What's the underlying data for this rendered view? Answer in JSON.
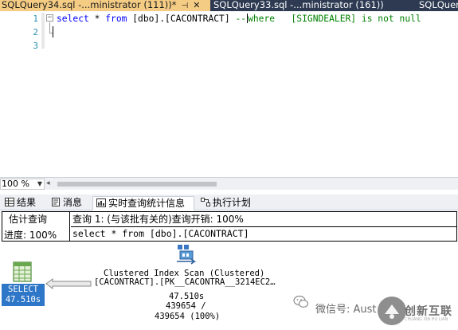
{
  "tabs": [
    {
      "label": "SQLQuery34.sql -...ministrator (111))*",
      "pin_glyph": "⊣",
      "close_glyph": "✕"
    },
    {
      "label": "SQLQuery33.sql -...ministrator (161))"
    },
    {
      "label": "SQLQuer"
    }
  ],
  "editor": {
    "line_numbers": [
      "1",
      "2",
      "3"
    ],
    "code": {
      "kw_select": "select",
      "star": " * ",
      "kw_from": "from",
      "object": " [dbo].[CACONTRACT] ",
      "comment_a": "--",
      "comment_b": "where   [SIGNDEALER] is not null"
    },
    "fold_glyph": "−"
  },
  "zoom": {
    "value": "100 %",
    "arrow": "▼",
    "scroll_left": "◂"
  },
  "result_tabs": [
    {
      "label": "结果",
      "icon": "grid-icon"
    },
    {
      "label": "消息",
      "icon": "message-icon"
    },
    {
      "label": "实时查询统计信息",
      "icon": "live-stats-icon"
    },
    {
      "label": "执行计划",
      "icon": "execution-plan-icon"
    }
  ],
  "stats": {
    "estimate_label": "估计查询",
    "progress_label": "进度: 100%",
    "query_header": "查询 1: (与该批有关的)查询开销: 100%",
    "query_text": "select * from [dbo].[CACONTRACT]"
  },
  "plan": {
    "select_node": {
      "label": "SELECT",
      "time": "47.510s"
    },
    "scan_node": {
      "title": "Clustered Index Scan (Clustered)",
      "object": "[CACONTRACT].[PK__CACONTRA__3214EC2…",
      "time": "47.510s",
      "rows": "439654 /",
      "total": "439654 (100%)"
    }
  },
  "watermark": {
    "wechat": "微信号: Aust",
    "brand": "创新互联",
    "sub": "CHUANG XIN HU LIAN"
  },
  "colors": {
    "tab_active": "#f5cc84",
    "tab_bar": "#2d3a52",
    "select_node": "#2e76c7",
    "keyword": "#0000ff",
    "comment": "#008000",
    "line_number": "#2b91af"
  }
}
